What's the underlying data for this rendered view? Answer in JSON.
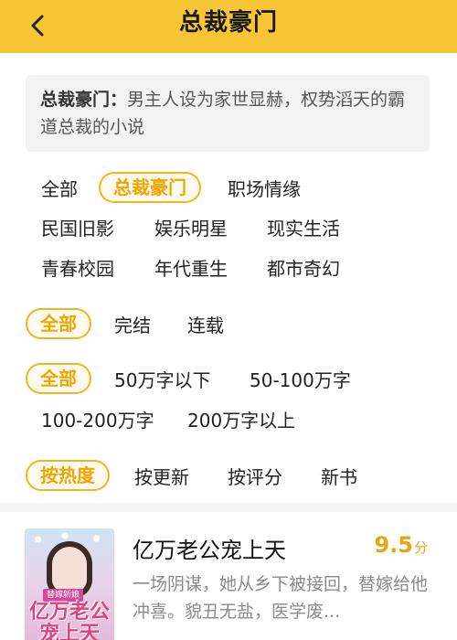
{
  "header": {
    "title": "总裁豪门",
    "back_icon": "chevron-left-icon",
    "bg_color": "#f7c535"
  },
  "description": {
    "label": "总裁豪门：",
    "text": "男主人设为家世显赫，权势滔天的霸道总裁的小说"
  },
  "filters": {
    "categories": [
      "全部",
      "总裁豪门",
      "职场情缘",
      "民国旧影",
      "娱乐明星",
      "现实生活",
      "青春校园",
      "年代重生",
      "都市奇幻"
    ],
    "categories_selected": "总裁豪门",
    "status": [
      "全部",
      "完结",
      "连载"
    ],
    "status_selected": "全部",
    "word_count": [
      "全部",
      "50万字以下",
      "50-100万字",
      "100-200万字",
      "200万字以上"
    ],
    "word_count_selected": "全部",
    "sort": [
      "按热度",
      "按更新",
      "按评分",
      "新书"
    ],
    "sort_selected": "按热度",
    "accent_color": "#f0a500"
  },
  "books": [
    {
      "title": "亿万老公宠上天",
      "score": "9.5",
      "score_unit": "分",
      "description": "一场阴谋，她从乡下被接回，替嫁给他冲喜。貌丑无盐，医学废...",
      "cover_tag": "替嫁新娘",
      "cover_title": "亿万老公宠上天"
    }
  ]
}
